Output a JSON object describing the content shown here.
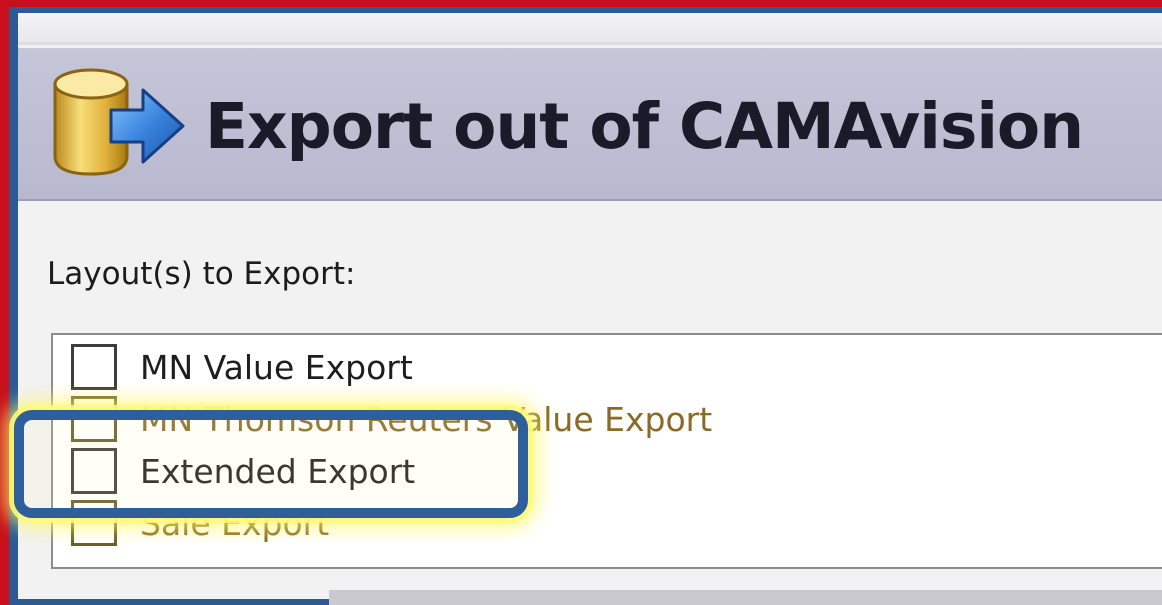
{
  "header": {
    "title": "Export out of CAMAvision",
    "icon": "database-export-icon"
  },
  "layouts": {
    "label": "Layout(s) to Export:",
    "items": [
      {
        "label": "MN Value Export",
        "checked": false
      },
      {
        "label": "MN Thomson Reuters Value Export",
        "checked": false
      },
      {
        "label": "Extended Export",
        "checked": false
      },
      {
        "label": "Sale Export",
        "checked": false
      }
    ]
  },
  "annotation": {
    "highlighted_item": "Extended Export",
    "outline_color": "#2e5f9b",
    "glow_color": "#fff564"
  },
  "colors": {
    "frame_border": "#c8101c",
    "inner_border": "#2d5a91",
    "header_bg": "#c6c6d9"
  }
}
